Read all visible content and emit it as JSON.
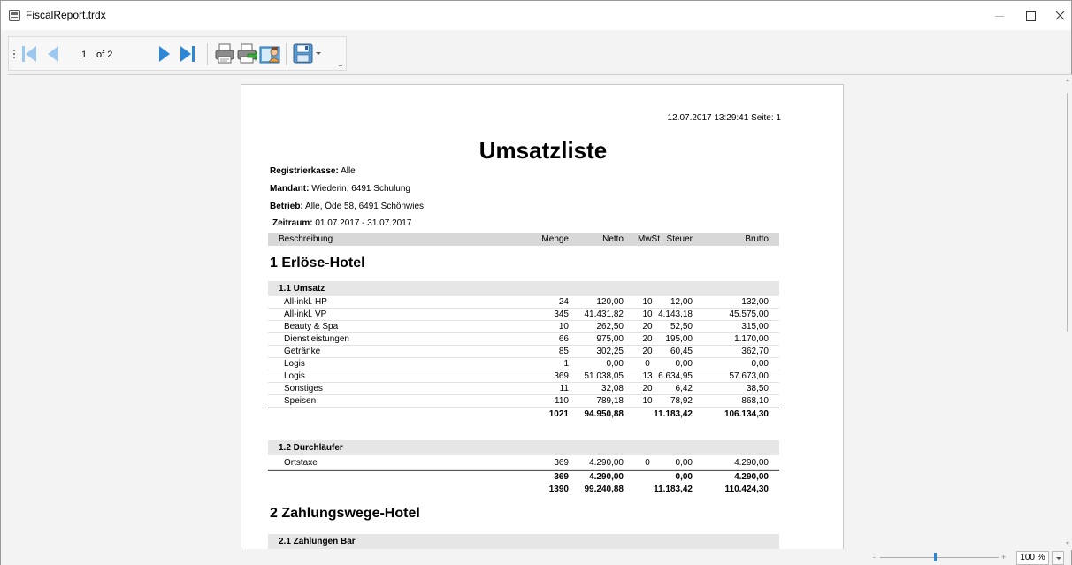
{
  "window": {
    "title": "FiscalReport.trdx"
  },
  "toolbar": {
    "current_page": "1",
    "page_of": "of 2",
    "buttons": [
      "first-page",
      "previous-page",
      "next-page",
      "last-page",
      "print",
      "print-preview",
      "page-setup",
      "export",
      "export-dropdown"
    ]
  },
  "report": {
    "header_info": "12.07.2017 13:29:41  Seite: 1",
    "title": "Umsatzliste",
    "meta": [
      {
        "label": "Registrierkasse:",
        "value": "Alle"
      },
      {
        "label": "Mandant:",
        "value": "Wiederin, 6491 Schulung"
      },
      {
        "label": "Betrieb:",
        "value": "Alle, Öde 58, 6491 Schönwies"
      },
      {
        "label": "Zeitraum:",
        "value": "01.07.2017 - 31.07.2017"
      }
    ],
    "columns": [
      "Beschreibung",
      "Menge",
      "Netto",
      "MwSt",
      "Steuer",
      "Brutto"
    ],
    "section1": {
      "title": "1 Erlöse-Hotel",
      "sub1": {
        "title": "1.1 Umsatz",
        "rows": [
          [
            "All-inkl. HP",
            "24",
            "120,00",
            "10",
            "12,00",
            "132,00"
          ],
          [
            "All-inkl. VP",
            "345",
            "41.431,82",
            "10",
            "4.143,18",
            "45.575,00"
          ],
          [
            "Beauty & Spa",
            "10",
            "262,50",
            "20",
            "52,50",
            "315,00"
          ],
          [
            "Dienstleistungen",
            "66",
            "975,00",
            "20",
            "195,00",
            "1.170,00"
          ],
          [
            "Getränke",
            "85",
            "302,25",
            "20",
            "60,45",
            "362,70"
          ],
          [
            "Logis",
            "1",
            "0,00",
            "0",
            "0,00",
            "0,00"
          ],
          [
            "Logis",
            "369",
            "51.038,05",
            "13",
            "6.634,95",
            "57.673,00"
          ],
          [
            "Sonstiges",
            "11",
            "32,08",
            "20",
            "6,42",
            "38,50"
          ],
          [
            "Speisen",
            "110",
            "789,18",
            "10",
            "78,92",
            "868,10"
          ]
        ],
        "total": [
          "",
          "1021",
          "94.950,88",
          "",
          "11.183,42",
          "106.134,30"
        ]
      },
      "sub2": {
        "title": "1.2 Durchläufer",
        "rows": [
          [
            "Ortstaxe",
            "369",
            "4.290,00",
            "0",
            "0,00",
            "4.290,00"
          ]
        ],
        "total": [
          "",
          "369",
          "4.290,00",
          "",
          "0,00",
          "4.290,00"
        ]
      },
      "grand_total": [
        "",
        "1390",
        "99.240,88",
        "",
        "11.183,42",
        "110.424,30"
      ]
    },
    "section2": {
      "title": "2 Zahlungswege-Hotel",
      "sub1": {
        "title": "2.1 Zahlungen Bar"
      }
    }
  },
  "statusbar": {
    "zoom_minus": "-",
    "zoom_plus": "+",
    "zoom_level": "100 %",
    "zoom_slider_fraction": 0.46
  }
}
